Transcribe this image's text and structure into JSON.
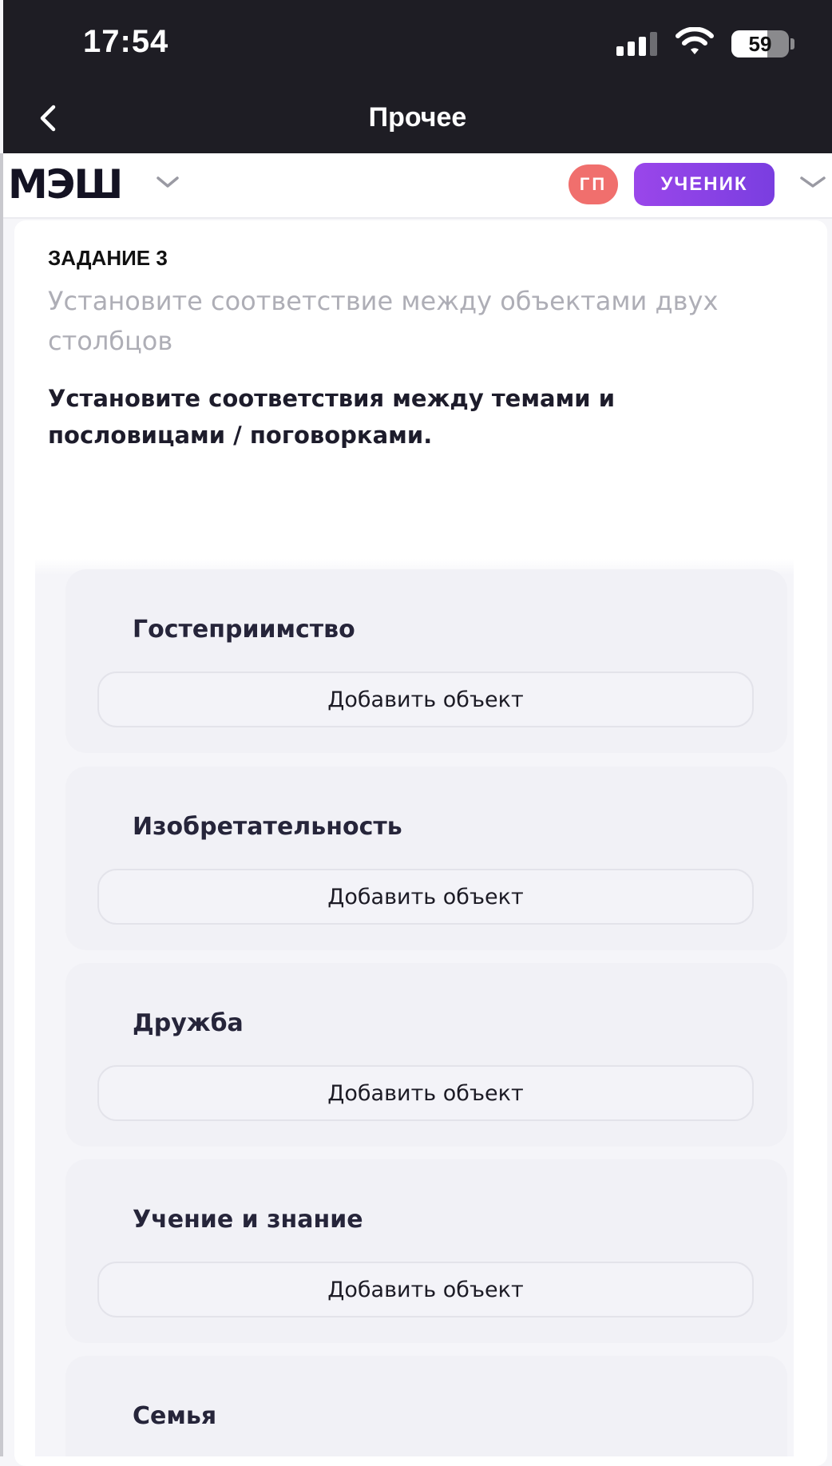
{
  "status_bar": {
    "time": "17:54",
    "battery": "59"
  },
  "nav": {
    "title": "Прочее"
  },
  "app": {
    "logo": "МЭШ",
    "avatar_initials": "ГП",
    "role": "УЧЕНИК"
  },
  "task": {
    "number": "ЗАДАНИЕ 3",
    "type": "Установите соответствие между объектами двух столбцов",
    "instruction": "Установите соответствия между темами и пословицами / поговорками."
  },
  "groups": [
    {
      "title": "Гостеприимство",
      "button": "Добавить объект"
    },
    {
      "title": "Изобретательность",
      "button": "Добавить объект"
    },
    {
      "title": "Дружба",
      "button": "Добавить объект"
    },
    {
      "title": "Учение и знание",
      "button": "Добавить объект"
    },
    {
      "title": "Семья"
    }
  ]
}
